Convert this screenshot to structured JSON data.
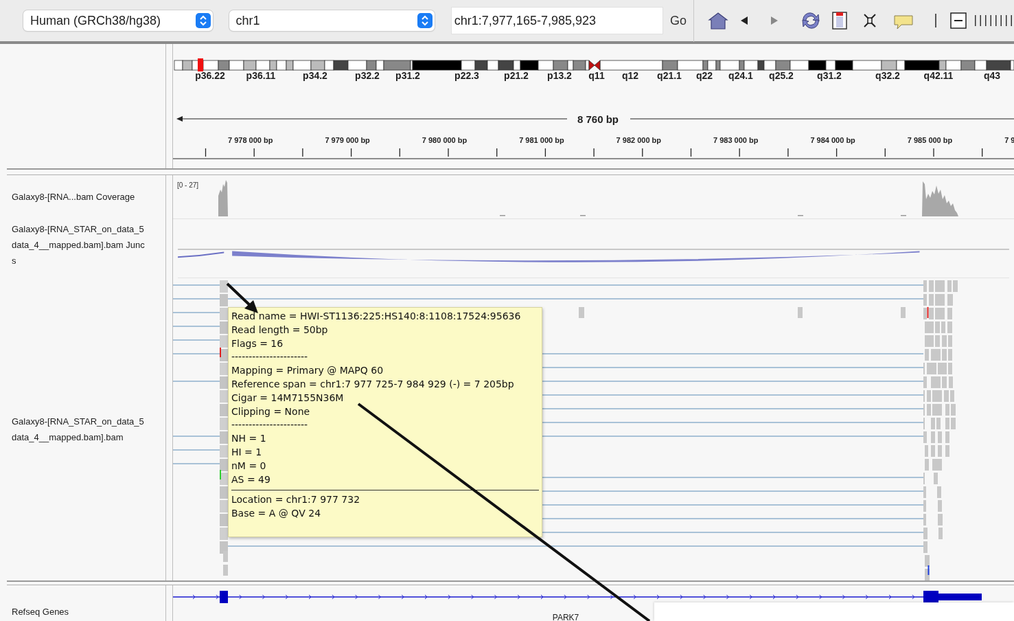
{
  "toolbar": {
    "genome": "Human (GRCh38/hg38)",
    "chromosome": "chr1",
    "locus": "chr1:7,977,165-7,985,923",
    "go": "Go"
  },
  "ideogram": {
    "bands": [
      "p36.22",
      "p36.11",
      "p34.2",
      "p32.2",
      "p31.2",
      "p22.3",
      "p21.2",
      "p13.2",
      "q11",
      "q12",
      "q21.1",
      "q22",
      "q24.1",
      "q25.2",
      "q31.2",
      "q32.2",
      "q42.11",
      "q43"
    ]
  },
  "ruler": {
    "span": "8 760 bp",
    "ticks": [
      "7 978 000 bp",
      "7 979 000 bp",
      "7 980 000 bp",
      "7 981 000 bp",
      "7 982 000 bp",
      "7 983 000 bp",
      "7 984 000 bp",
      "7 985 000 bp",
      "7 9"
    ]
  },
  "tracks": [
    {
      "kind": "coverage",
      "name_lines": [
        "Galaxy8-[RNA...bam Coverage"
      ],
      "range": "[0 - 27]"
    },
    {
      "kind": "junctions",
      "name_lines": [
        "Galaxy8-[RNA_STAR_on_data_5",
        "data_4__mapped.bam].bam Junc",
        "s"
      ]
    },
    {
      "kind": "alignments",
      "name_lines": [
        "Galaxy8-[RNA_STAR_on_data_5",
        "data_4__mapped.bam].bam"
      ]
    }
  ],
  "popup": {
    "lines": [
      {
        "kind": "text",
        "text": "Read name = HWI-ST1136:225:HS140:8:1108:17524:95636"
      },
      {
        "kind": "text",
        "text": "Read length = 50bp"
      },
      {
        "kind": "text",
        "text": "Flags = 16"
      },
      {
        "kind": "text",
        "text": "----------------------"
      },
      {
        "kind": "text",
        "text": "Mapping = Primary @ MAPQ 60"
      },
      {
        "kind": "text",
        "text": "Reference span = chr1:7 977 725-7 984 929 (-) = 7 205bp"
      },
      {
        "kind": "text",
        "text": "Cigar = 14M7155N36M"
      },
      {
        "kind": "text",
        "text": "Clipping = None"
      },
      {
        "kind": "text",
        "text": "----------------------"
      },
      {
        "kind": "text",
        "text": "NH = 1"
      },
      {
        "kind": "text",
        "text": "HI = 1"
      },
      {
        "kind": "text",
        "text": "nM = 0"
      },
      {
        "kind": "text",
        "text": "AS = 49"
      },
      {
        "kind": "rule"
      },
      {
        "kind": "text",
        "text": "Location = chr1:7 977 732"
      },
      {
        "kind": "text",
        "text": "Base = A @ QV 24"
      }
    ]
  },
  "genes": {
    "name": "Refseq Genes",
    "gene": "PARK7"
  }
}
